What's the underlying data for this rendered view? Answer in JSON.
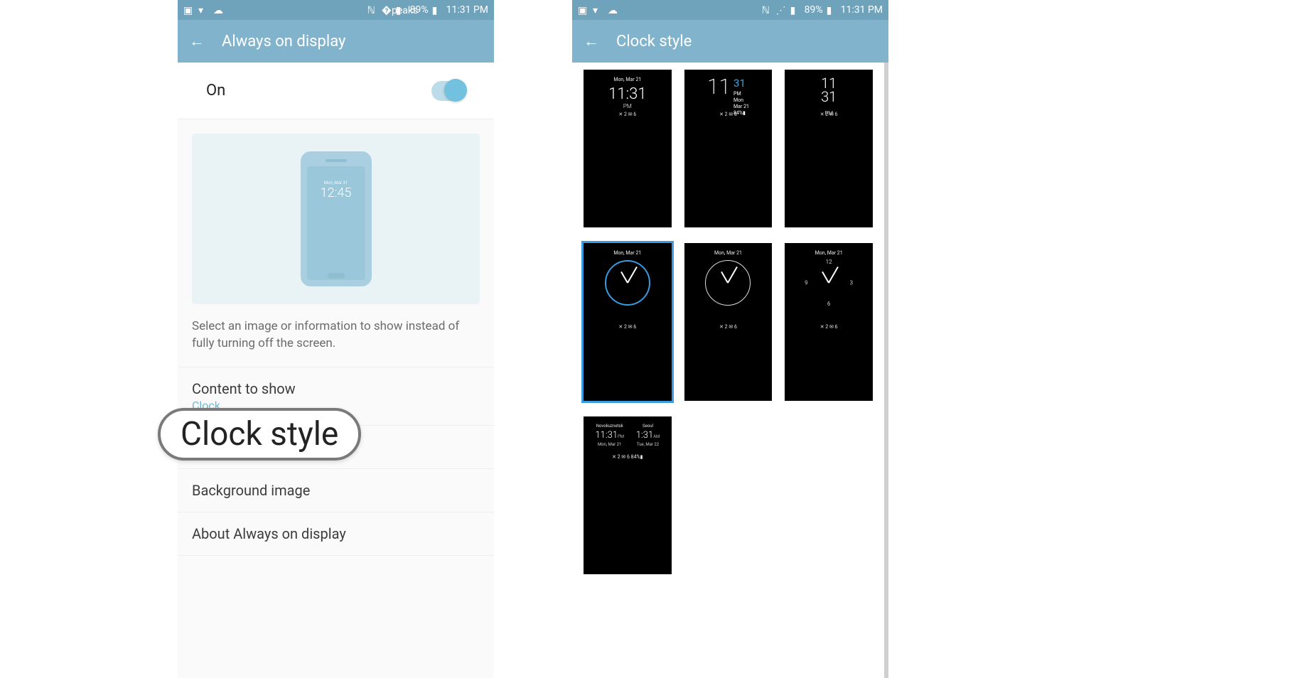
{
  "statusbar": {
    "battery_text": "89%",
    "time": "11:31 PM"
  },
  "screen1": {
    "title": "Always on display",
    "toggle_label": "On",
    "preview_date": "Mon, Mar 21",
    "preview_time": "12:45",
    "description": "Select an image or information to show instead of fully turning off the screen.",
    "menu": {
      "content_to_show": {
        "label": "Content to show",
        "value": "Clock"
      },
      "clock_style": {
        "label": "Clock style"
      },
      "background_image": {
        "label": "Background image"
      },
      "about": {
        "label": "About Always on display"
      }
    }
  },
  "callout": {
    "text": "Clock style"
  },
  "screen2": {
    "title": "Clock style",
    "sample_date": "Mon, Mar 21",
    "status_row": "✕ 2    ✉ 6",
    "battery_row_full": "✕ 2   ✉ 6   84%▮",
    "s1": {
      "time": "11:31",
      "pm": "PM"
    },
    "s2": {
      "hour": "11",
      "min": "31",
      "pm": "PM",
      "mon": "Mon",
      "day": "Mar 21",
      "bat": "84%▮"
    },
    "s3": {
      "hour": "11",
      "min": "31",
      "pm": "PM"
    },
    "s7": {
      "city1": "Novokuznetsk",
      "time1": "11:31",
      "ap1": "PM",
      "date1": "Mon, Mar 21",
      "city2": "Seoul",
      "time2": "1:31",
      "ap2": "AM",
      "date2": "Tue, Mar 22"
    }
  }
}
